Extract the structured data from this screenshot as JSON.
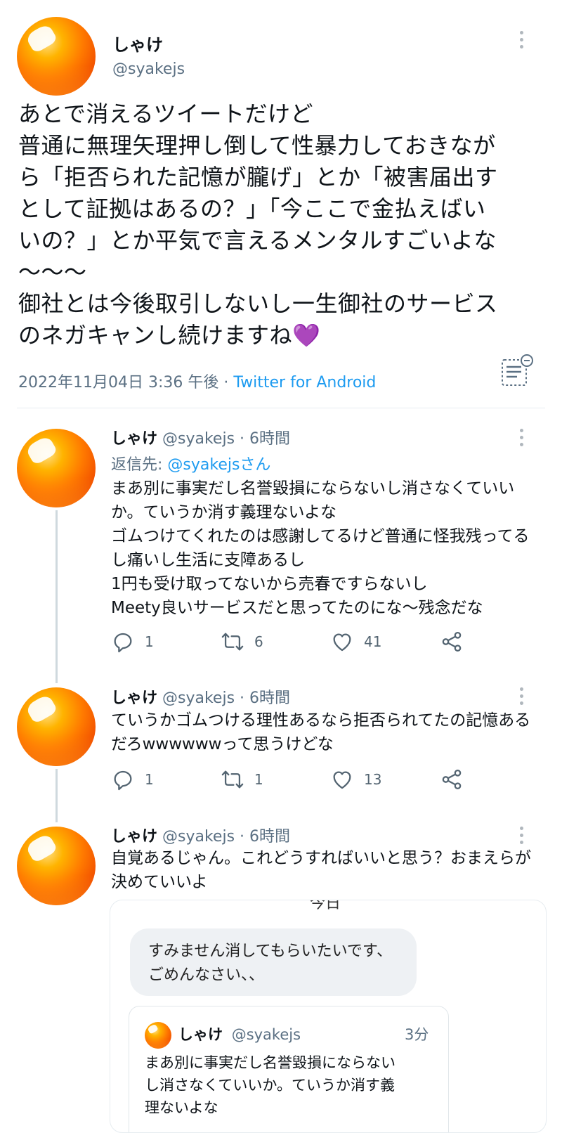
{
  "main_tweet": {
    "name": "しゃけ",
    "handle": "@syakejs",
    "lines": [
      "あとで消えるツイートだけど",
      "普通に無理矢理押し倒して性暴力しておきなが",
      "ら「拒否られた記憶が朧げ」とか「被害届出す",
      "として証拠はあるの？」「今ここで金払えばい",
      "いの？」とか平気で言えるメンタルすごいよな",
      "〜〜〜",
      "御社とは今後取引しないし一生御社のサービス",
      "のネガキャンし続けますね💜"
    ],
    "timestamp": "2022年11月04日 3:36 午後",
    "separator": " · ",
    "source": "Twitter for Android"
  },
  "replies": [
    {
      "name": "しゃけ",
      "handle": "@syakejs",
      "time": "· 6時間",
      "reply_to_prefix": "返信先: ",
      "reply_to_handle": "@syakejsさん",
      "lines": [
        "まあ別に事実だし名誉毀損にならないし消さなくていい",
        "か。ていうか消す義理ないよな",
        "ゴムつけてくれたのは感謝してるけど普通に怪我残ってる",
        "し痛いし生活に支障あるし",
        "1円も受け取ってないから売春ですらないし",
        "Meety良いサービスだと思ってたのにな〜残念だな"
      ],
      "counts": {
        "reply": "1",
        "retweet": "6",
        "like": "41"
      }
    },
    {
      "name": "しゃけ",
      "handle": "@syakejs",
      "time": "· 6時間",
      "lines": [
        "ていうかゴムつける理性あるなら拒否られてたの記憶ある",
        "だろwwwwwwって思うけどな"
      ],
      "counts": {
        "reply": "1",
        "retweet": "1",
        "like": "13"
      }
    },
    {
      "name": "しゃけ",
      "handle": "@syakejs",
      "time": "· 6時間",
      "lines": [
        "自覚あるじゃん。これどうすればいいと思う？おまえらが",
        "決めていいよ"
      ]
    }
  ],
  "embedded_screenshot": {
    "cut_header": "今日",
    "bubble_lines": [
      "すみません消してもらいたいです、",
      "ごめんなさい、、"
    ],
    "quote": {
      "name": "しゃけ",
      "handle": "@syakejs",
      "time": "3分",
      "lines": [
        "まあ別に事実だし名誉毀損にならない",
        "し消さなくていいか。ていうか消す義",
        "理ないよな"
      ]
    }
  },
  "icons": {
    "more": "more-vertical-icon",
    "reply": "reply-icon",
    "retweet": "retweet-icon",
    "like": "heart-icon",
    "share": "share-icon",
    "notes": "notes-icon"
  },
  "colors": {
    "link": "#1d9bf0",
    "muted": "#5b7083",
    "text": "#0f1419",
    "bubble": "#eef1f4"
  }
}
